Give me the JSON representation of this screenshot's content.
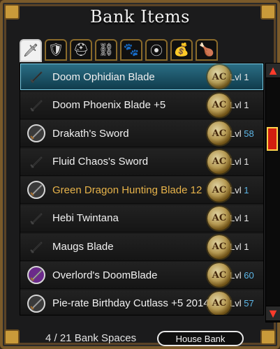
{
  "header": {
    "title": "Bank Items"
  },
  "tabs": [
    {
      "label": "Swords",
      "icon": "sword-icon",
      "glyph": "🗡"
    },
    {
      "label": "Armor",
      "icon": "armor-icon",
      "glyph": "🛡"
    },
    {
      "label": "Helms",
      "icon": "helm-icon",
      "glyph": "⛑"
    },
    {
      "label": "Capes",
      "icon": "cape-icon",
      "glyph": "⛓"
    },
    {
      "label": "Pets",
      "icon": "paw-icon",
      "glyph": "🐾"
    },
    {
      "label": "Necklaces",
      "icon": "necklace-icon",
      "glyph": "⦿"
    },
    {
      "label": "Bags",
      "icon": "bag-icon",
      "glyph": "💰"
    },
    {
      "label": "Items",
      "icon": "item-icon",
      "glyph": "🍗"
    }
  ],
  "items": [
    {
      "name": "Doom Ophidian Blade",
      "level": "1",
      "levelColor": "white",
      "icon": "dark-sword-icon"
    },
    {
      "name": "Doom Phoenix Blade +5",
      "level": "1",
      "levelColor": "white",
      "icon": "dark-sword-icon"
    },
    {
      "name": "Drakath's Sword",
      "level": "58",
      "levelColor": "blue",
      "icon": "silver-sword-icon"
    },
    {
      "name": "Fluid Chaos's Sword",
      "level": "1",
      "levelColor": "white",
      "icon": "dark-sword-icon"
    },
    {
      "name": "Green Dragon Hunting Blade 12",
      "level": "1",
      "levelColor": "blue",
      "icon": "silver-sword-icon"
    },
    {
      "name": "Hebi Twintana",
      "level": "1",
      "levelColor": "white",
      "icon": "dark-sword-icon"
    },
    {
      "name": "Maugs Blade",
      "level": "1",
      "levelColor": "white",
      "icon": "dark-sword-icon"
    },
    {
      "name": "Overlord's DoomBlade",
      "level": "60",
      "levelColor": "blue",
      "icon": "purple-sword-icon"
    },
    {
      "name": "Pie-rate Birthday Cutlass +5 2014",
      "level": "57",
      "levelColor": "blue",
      "icon": "silver-sword-icon"
    }
  ],
  "selectedIndex": 0,
  "highlightIndex": 4,
  "footer": {
    "bankSpacesText": "4 / 21 Bank Spaces",
    "houseBankLabel": "House Bank"
  },
  "lvlPrefix": "Lvl",
  "acBadgeText": "AC"
}
